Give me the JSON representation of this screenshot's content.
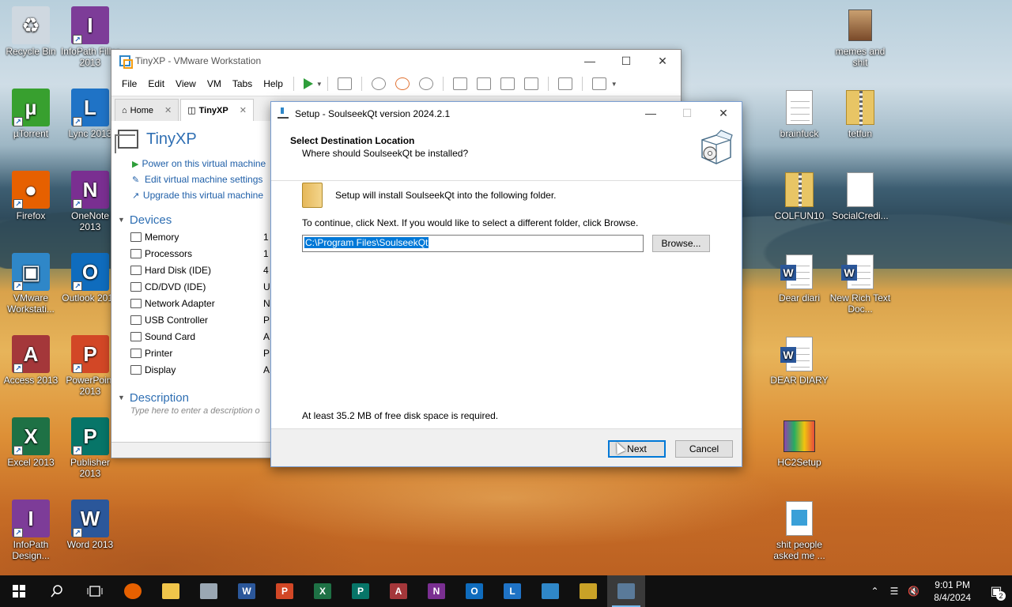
{
  "desktop": {
    "icons_left": [
      {
        "label": "Recycle Bin",
        "icon": "recycle-bin-icon",
        "color": "#cfd8e0",
        "glyph": "♻"
      },
      {
        "label": "InfoPath Filler 2013",
        "icon": "infopath-icon",
        "color": "#7d3c98",
        "glyph": "I"
      },
      {
        "label": "µTorrent",
        "icon": "utorrent-icon",
        "color": "#38a02f",
        "glyph": "µ"
      },
      {
        "label": "Lync 2013",
        "icon": "lync-icon",
        "color": "#1f73c6",
        "glyph": "L"
      },
      {
        "label": "Firefox",
        "icon": "firefox-icon",
        "color": "#e66000",
        "glyph": "●"
      },
      {
        "label": "OneNote 2013",
        "icon": "onenote-icon",
        "color": "#7a2f91",
        "glyph": "N"
      },
      {
        "label": "VMware Workstati...",
        "icon": "vmware-icon",
        "color": "#2f87c8",
        "glyph": "▣"
      },
      {
        "label": "Outlook 2013",
        "icon": "outlook-icon",
        "color": "#0f6cbd",
        "glyph": "O"
      },
      {
        "label": "Access 2013",
        "icon": "access-icon",
        "color": "#a4373a",
        "glyph": "A"
      },
      {
        "label": "PowerPoint 2013",
        "icon": "powerpoint-icon",
        "color": "#d24726",
        "glyph": "P"
      },
      {
        "label": "Excel 2013",
        "icon": "excel-icon",
        "color": "#1e7145",
        "glyph": "X"
      },
      {
        "label": "Publisher 2013",
        "icon": "publisher-icon",
        "color": "#077568",
        "glyph": "P"
      },
      {
        "label": "InfoPath Design...",
        "icon": "infopath-designer-icon",
        "color": "#7d3c98",
        "glyph": "I"
      },
      {
        "label": "Word 2013",
        "icon": "word-icon",
        "color": "#2b579a",
        "glyph": "W"
      }
    ],
    "icons_right": [
      {
        "label": "memes and shit",
        "icon": "image-file-icon"
      },
      {
        "label": "brainfuck",
        "icon": "text-file-icon"
      },
      {
        "label": "tetfun",
        "icon": "zip-folder-icon"
      },
      {
        "label": "COLFUN10",
        "icon": "zip-folder-icon"
      },
      {
        "label": "SocialCredi...",
        "icon": "blank-file-icon"
      },
      {
        "label": "Dear diari",
        "icon": "word-doc-icon"
      },
      {
        "label": "New Rich Text Doc...",
        "icon": "word-doc-icon"
      },
      {
        "label": "DEAR DIARY",
        "icon": "word-doc-icon"
      },
      {
        "label": "HC2Setup",
        "icon": "installer-icon"
      },
      {
        "label": "shit people asked me ...",
        "icon": "file-icon"
      }
    ]
  },
  "vmware": {
    "title": "TinyXP - VMware Workstation",
    "menu": [
      "File",
      "Edit",
      "View",
      "VM",
      "Tabs",
      "Help"
    ],
    "tabs": [
      {
        "label": "Home",
        "active": false
      },
      {
        "label": "TinyXP",
        "active": true
      }
    ],
    "vm_name": "TinyXP",
    "actions": [
      "Power on this virtual machine",
      "Edit virtual machine settings",
      "Upgrade this virtual machine"
    ],
    "devices_header": "Devices",
    "devices": [
      {
        "name": "Memory",
        "value": "1"
      },
      {
        "name": "Processors",
        "value": "1"
      },
      {
        "name": "Hard Disk (IDE)",
        "value": "4"
      },
      {
        "name": "CD/DVD (IDE)",
        "value": "U"
      },
      {
        "name": "Network Adapter",
        "value": "N"
      },
      {
        "name": "USB Controller",
        "value": "P"
      },
      {
        "name": "Sound Card",
        "value": "A"
      },
      {
        "name": "Printer",
        "value": "P"
      },
      {
        "name": "Display",
        "value": "A"
      }
    ],
    "description_header": "Description",
    "description_placeholder": "Type here to enter a description o"
  },
  "setup": {
    "title": "Setup - SoulseekQt version 2024.2.1",
    "heading": "Select Destination Location",
    "subheading": "Where should SoulseekQt be installed?",
    "install_line": "Setup will install SoulseekQt into the following folder.",
    "continue_line": "To continue, click Next. If you would like to select a different folder, click Browse.",
    "path_value": "C:\\Program Files\\SoulseekQt",
    "browse_label": "Browse...",
    "disk_requirement": "At least 35.2 MB of free disk space is required.",
    "next_label": "Next",
    "cancel_label": "Cancel"
  },
  "taskbar": {
    "time": "9:01 PM",
    "date": "8/4/2024",
    "notification_count": "2"
  }
}
